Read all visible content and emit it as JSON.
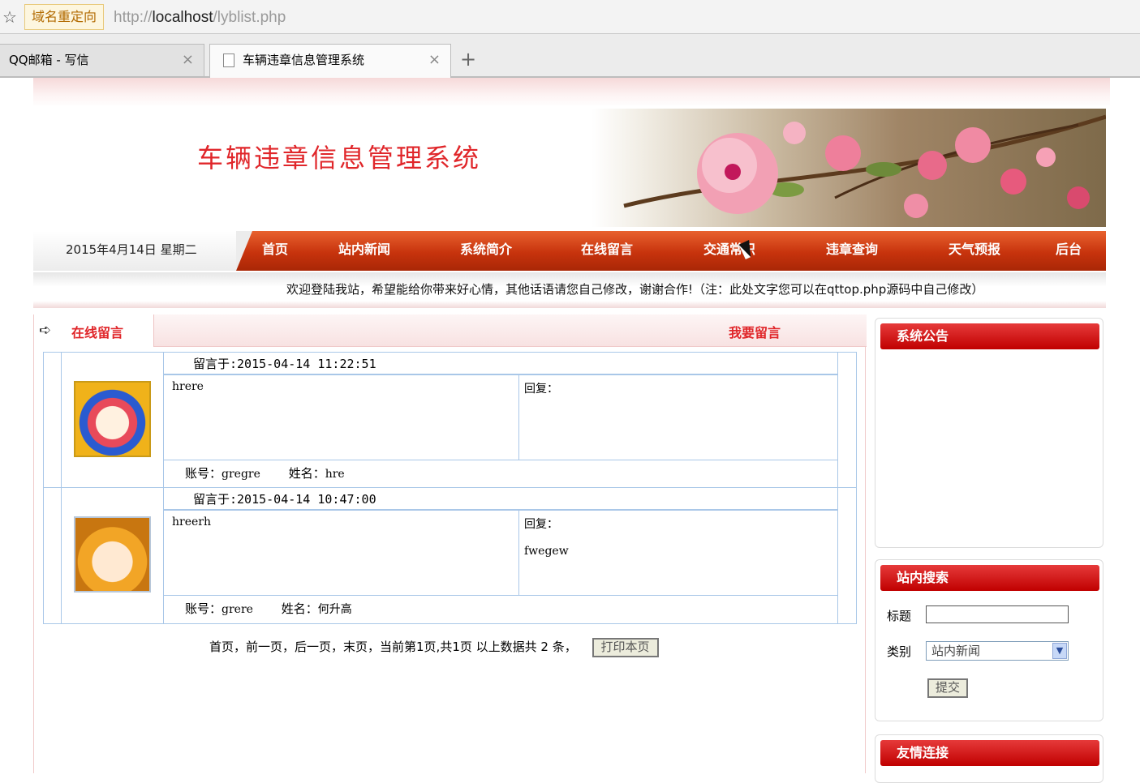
{
  "browser": {
    "redirect_label": "域名重定向",
    "url_scheme": "http://",
    "url_host": "localhost",
    "url_path": "/lyblist.php",
    "tabs": [
      {
        "label": "QQ邮箱 - 写信"
      },
      {
        "label": "车辆违章信息管理系统"
      }
    ],
    "new_tab": "+",
    "tab_close": "×"
  },
  "site": {
    "title": "车辆违章信息管理系统",
    "date": "2015年4月14日 星期二",
    "nav": [
      "首页",
      "站内新闻",
      "系统简介",
      "在线留言",
      "交通常识",
      "违章查询",
      "天气预报",
      "后台"
    ],
    "welcome": "欢迎登陆我站，希望能给你带来好心情，其他话语请您自己修改，谢谢合作!（注：此处文字您可以在qttop.php源码中自己修改）"
  },
  "section": {
    "title": "在线留言",
    "leave_message": "我要留言"
  },
  "messages": [
    {
      "time": "留言于:2015-04-14 11:22:51",
      "content": "hrere",
      "reply_label": "回复：",
      "reply": "",
      "account_label": "账号：",
      "account": "gregre",
      "name_label": "姓名：",
      "name": "hre"
    },
    {
      "time": "留言于:2015-04-14 10:47:00",
      "content": "hreerh",
      "reply_label": "回复：",
      "reply": "fwegew",
      "account_label": "账号：",
      "account": "grere",
      "name_label": "姓名：",
      "name": "何升高"
    }
  ],
  "pager": {
    "text": "首页，前一页，后一页，末页，当前第1页,共1页 以上数据共 2 条，",
    "print_button": "打印本页"
  },
  "sidebar": {
    "notice_title": "系统公告",
    "search_title": "站内搜索",
    "title_label": "标题",
    "title_value": "",
    "type_label": "类别",
    "type_selected": "站内新闻",
    "submit_button": "提交",
    "links_title": "友情连接"
  },
  "icons": {
    "star": "star-icon",
    "arrow": "arrow-right-icon",
    "cursor": "mouse-cursor-icon"
  },
  "colors": {
    "accent_red": "#e0262a",
    "nav_orange": "#c7330d",
    "table_border": "#a9c7e8"
  }
}
